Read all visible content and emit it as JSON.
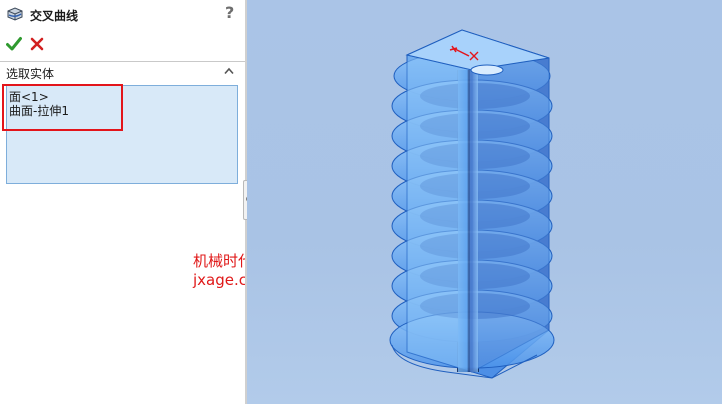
{
  "panel": {
    "title": "交叉曲线",
    "help": "?",
    "section": {
      "title": "选取实体",
      "items": [
        "面<1>",
        "曲面-拉伸1"
      ]
    }
  },
  "watermark": {
    "line1": "机械时代网",
    "line2": "jxage.com"
  },
  "colors": {
    "viewport_bg": "#aac4e7",
    "model_fill": "#6fb0f5",
    "model_edge": "#1f5fbf",
    "highlight_frame": "#e3151b",
    "selection_bg": "#d8e9f8",
    "ok": "#2f9a2f",
    "cancel": "#d21f1f"
  },
  "icons": {
    "feature": "intersection-curve-icon",
    "ok": "checkmark-icon",
    "cancel": "x-icon",
    "collapse": "chevron-up-icon"
  }
}
